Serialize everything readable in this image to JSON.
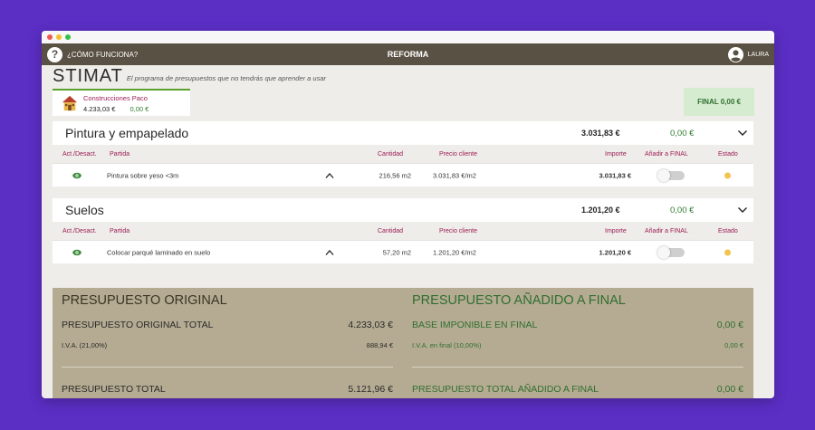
{
  "topbar": {
    "help_label": "¿CÓMO FUNCIONA?",
    "help_icon_char": "?",
    "title": "REFORMA",
    "user_name": "LAURA"
  },
  "brand": {
    "logo": "STIMAT",
    "tagline": "El programa de presupuestos que no tendrás que aprender a usar"
  },
  "client": {
    "name": "Construcciones Paco",
    "total": "4.233,03 €",
    "final": "0,00 €"
  },
  "final_badge": "FINAL 0,00 €",
  "columns": {
    "toggle": "Act./Desact.",
    "partida": "Partida",
    "cantidad": "Cantidad",
    "precio": "Precio cliente",
    "importe": "Importe",
    "anadir": "Añadir a FINAL",
    "estado": "Estado"
  },
  "sections": [
    {
      "title": "Pintura y empapelado",
      "total": "3.031,83 €",
      "final": "0,00 €",
      "row": {
        "partida": "Pintura sobre yeso <3m",
        "cantidad": "216,56 m2",
        "precio": "3.031,83 €/m2",
        "importe": "3.031,83 €"
      }
    },
    {
      "title": "Suelos",
      "total": "1.201,20 €",
      "final": "0,00 €",
      "row": {
        "partida": "Colocar parqué laminado en suelo",
        "cantidad": "57,20 m2",
        "precio": "1.201,20 €/m2",
        "importe": "1.201,20 €"
      }
    }
  ],
  "summary": {
    "original": {
      "heading": "PRESUPUESTO ORIGINAL",
      "total_label": "PRESUPUESTO ORIGINAL TOTAL",
      "total_value": "4.233,03 €",
      "iva_label": "I.V.A. (21,00%)",
      "iva_value": "888,94 €",
      "grand_label": "PRESUPUESTO TOTAL",
      "grand_value": "5.121,96 €"
    },
    "final": {
      "heading": "PRESUPUESTO AÑADIDO A FINAL",
      "total_label": "BASE IMPONIBLE EN FINAL",
      "total_value": "0,00 €",
      "iva_label": "I.V.A. en final (10,00%)",
      "iva_value": "0,00 €",
      "grand_label": "PRESUPUESTO TOTAL AÑADIDO A FINAL",
      "grand_value": "0,00 €"
    }
  },
  "colors": {
    "background": "#5b2ec4",
    "topbar": "#595143",
    "accent_label": "#9a1b55",
    "accent_green": "#2f7d2f",
    "summary_bg": "#b5ab92",
    "status_pending": "#f2c44f"
  },
  "icons": {
    "help": "question-circle-icon",
    "user": "user-circle-icon",
    "client": "house-icon",
    "toggle": "eye-icon",
    "expand": "chevron-down-icon",
    "collapse_row": "chevron-up-icon"
  }
}
